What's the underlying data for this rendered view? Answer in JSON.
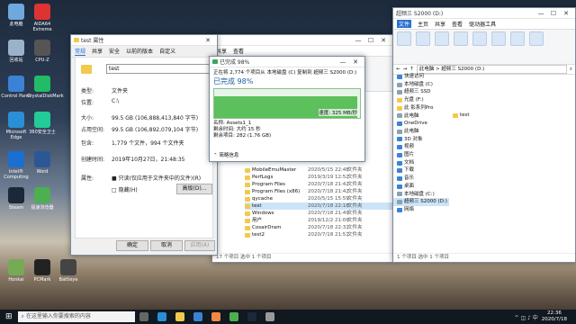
{
  "desktop_icons": [
    {
      "label": "此电脑",
      "color": "#6fa8dc"
    },
    {
      "label": "AIDA64 Extreme",
      "color": "#d33"
    },
    {
      "label": "回收站",
      "color": "#9cb2c9"
    },
    {
      "label": "CPU-Z",
      "color": "#555"
    },
    {
      "label": "Control Panel",
      "color": "#3b82d6"
    },
    {
      "label": "CrystalDiskMark",
      "color": "#2b6"
    },
    {
      "label": "Microsoft Edge",
      "color": "#2a8fd6"
    },
    {
      "label": "360安全卫士",
      "color": "#2c9"
    },
    {
      "label": "Intel® Computing",
      "color": "#1b6fd1"
    },
    {
      "label": "Word",
      "color": "#2b5797"
    },
    {
      "label": "Steam",
      "color": "#1b2838"
    },
    {
      "label": "极速浏览器",
      "color": "#4caf50"
    },
    {
      "label": "Honkai",
      "color": "#7a5"
    },
    {
      "label": "PCMark",
      "color": "#222"
    },
    {
      "label": "Battleye",
      "color": "#444"
    }
  ],
  "properties": {
    "title": "test 属性",
    "tabs": [
      "常规",
      "共享",
      "安全",
      "以前的版本",
      "自定义"
    ],
    "name": "test",
    "type_label": "类型:",
    "type_value": "文件夹",
    "loc_label": "位置:",
    "loc_value": "C:\\",
    "size_label": "大小:",
    "size_value": "99.5 GB (106,888,413,840 字节)",
    "disk_label": "占用空间:",
    "disk_value": "99.5 GB (106,892,079,104 字节)",
    "contains_label": "包含:",
    "contains_value": "1,779 个文件，994 个文件夹",
    "created_label": "创建时间:",
    "created_value": "2019年10月27日，21:48:35",
    "attr_label": "属性:",
    "readonly": "只读(仅应用于文件夹中的文件)(R)",
    "hidden": "隐藏(H)",
    "advanced": "高级(D)...",
    "ok": "确定",
    "cancel": "取消",
    "apply": "应用(A)"
  },
  "copy": {
    "title": "已完成 98%",
    "line1": "正在将 2,774 个项目从 本地磁盘 (C) 复制到 超频三 S2000 (D:)",
    "progress_text": "已完成 98%",
    "progress": 0.98,
    "speed": "速度: 325 MB/秒",
    "name_label": "名称: Assets1_1",
    "remaining_time": "剩余时间: 大约 15 秒",
    "remaining_items": "剩余项目: 282 (1.76 GB)",
    "details": "简略信息"
  },
  "explorer_c": {
    "tabs": [
      "共享",
      "查看"
    ],
    "rows": [
      {
        "name": "MobileEmuMaster",
        "date": "2020/5/15 22:48",
        "type": "文件夹"
      },
      {
        "name": "PerfLogs",
        "date": "2019/3/19 12:52",
        "type": "文件夹"
      },
      {
        "name": "Program Files",
        "date": "2020/7/18 21:42",
        "type": "文件夹"
      },
      {
        "name": "Program Files (x86)",
        "date": "2020/7/18 21:42",
        "type": "文件夹"
      },
      {
        "name": "qycache",
        "date": "2020/5/15 15:59",
        "type": "文件夹"
      },
      {
        "name": "test",
        "date": "2020/7/18 22:18",
        "type": "文件夹",
        "selected": true
      },
      {
        "name": "Windows",
        "date": "2020/7/18 21:49",
        "type": "文件夹"
      },
      {
        "name": "用户",
        "date": "2019/12/2 21:09",
        "type": "文件夹"
      },
      {
        "name": "CosairDram",
        "date": "2020/7/18 22:31",
        "type": "文件夹"
      },
      {
        "name": "test2",
        "date": "2020/7/18 21:51",
        "type": "文件夹"
      }
    ],
    "status": "17 个项目  选中 1 个项目"
  },
  "explorer_d": {
    "title": "超频三 S2000 (D:)",
    "tabs": [
      "文件",
      "主页",
      "共享",
      "查看",
      "驱动器工具"
    ],
    "address": "此电脑 > 超频三 S2000 (D:)",
    "nav": [
      "快速访问",
      "本地磁盘 (C)",
      "超频三 SSD",
      "光盘 (F:)",
      "此 影系列Pro",
      "此电脑",
      "OneDrive",
      "此电脑",
      "3D 对象",
      "视频",
      "图片",
      "文档",
      "下载",
      "音乐",
      "桌面",
      "本地磁盘 (C:)",
      "超频三 S2000 (D:)",
      "网络"
    ],
    "file": "test",
    "status": "1 个项目  选中 1 个项目"
  },
  "taskbar": {
    "search": "在这里输入你要搜索的内容",
    "time": "22:36",
    "date": "2020/7/18"
  }
}
